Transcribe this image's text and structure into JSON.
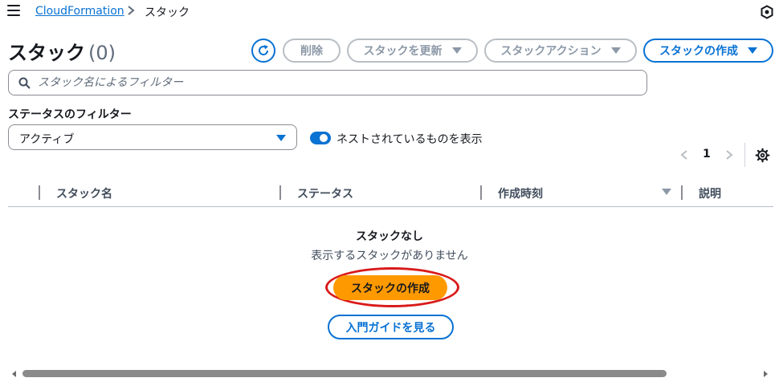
{
  "breadcrumb": {
    "root": "CloudFormation",
    "current": "スタック"
  },
  "header": {
    "title": "スタック",
    "count": "(0)"
  },
  "toolbar": {
    "delete_label": "削除",
    "update_label": "スタックを更新",
    "actions_label": "スタックアクション",
    "create_label": "スタックの作成"
  },
  "search": {
    "placeholder": "スタック名によるフィルター",
    "value": ""
  },
  "status_filter": {
    "label": "ステータスのフィルター",
    "selected": "アクティブ"
  },
  "nested_toggle": {
    "label": "ネストされているものを表示",
    "on": true
  },
  "pagination": {
    "current_page": "1"
  },
  "table": {
    "columns": [
      "スタック名",
      "ステータス",
      "作成時刻",
      "説明"
    ]
  },
  "empty_state": {
    "title": "スタックなし",
    "description": "表示するスタックがありません",
    "create_button": "スタックの作成",
    "guide_button": "入門ガイドを見る"
  },
  "colors": {
    "primary": "#0972d3",
    "accent": "#ff9900",
    "disabled": "#8d99a8",
    "annotation": "#d91a1a"
  },
  "icons": [
    "menu-icon",
    "chevron-right-icon",
    "cube-icon",
    "refresh-icon",
    "search-icon",
    "chevron-left-icon",
    "settings-icon",
    "sort-down-icon"
  ]
}
